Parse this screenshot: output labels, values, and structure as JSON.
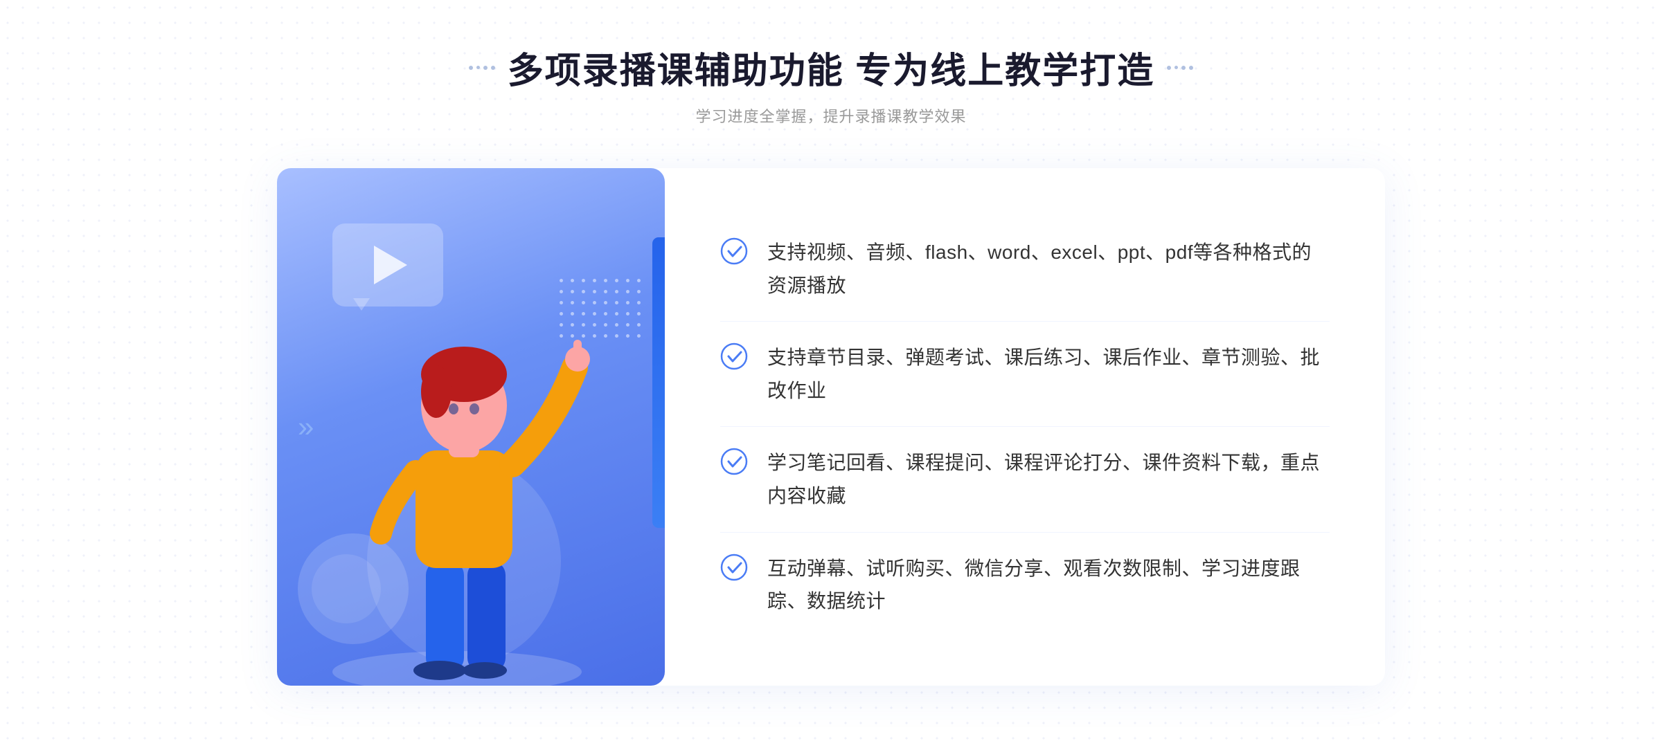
{
  "header": {
    "title": "多项录播课辅助功能 专为线上教学打造",
    "subtitle": "学习进度全掌握，提升录播课教学效果",
    "dots_decoration": [
      "●",
      "●",
      "●",
      "●"
    ]
  },
  "features": [
    {
      "id": 1,
      "text": "支持视频、音频、flash、word、excel、ppt、pdf等各种格式的资源播放"
    },
    {
      "id": 2,
      "text": "支持章节目录、弹题考试、课后练习、课后作业、章节测验、批改作业"
    },
    {
      "id": 3,
      "text": "学习笔记回看、课程提问、课程评论打分、课件资料下载，重点内容收藏"
    },
    {
      "id": 4,
      "text": "互动弹幕、试听购买、微信分享、观看次数限制、学习进度跟踪、数据统计"
    }
  ],
  "decorations": {
    "chevron": "»",
    "play_label": "play"
  }
}
